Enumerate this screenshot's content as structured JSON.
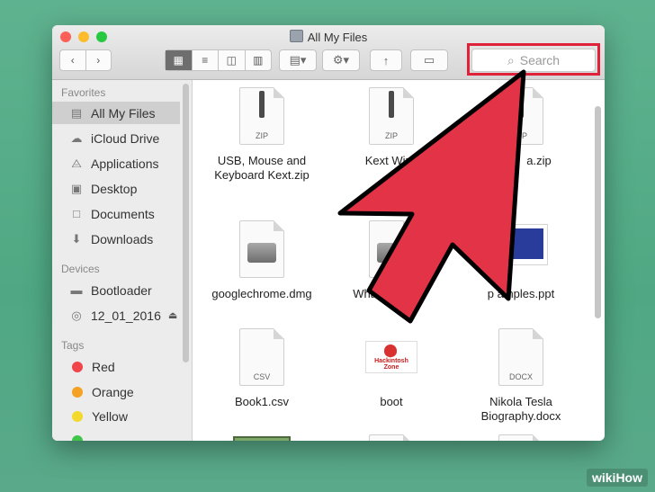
{
  "window": {
    "title": "All My Files"
  },
  "toolbar": {
    "back_icon": "chevron-left-icon",
    "forward_icon": "chevron-right-icon",
    "search_placeholder": "Search"
  },
  "sidebar": {
    "favorites_header": "Favorites",
    "favorites": [
      {
        "label": "All My Files",
        "icon": "all-files-icon",
        "selected": true
      },
      {
        "label": "iCloud Drive",
        "icon": "cloud-icon"
      },
      {
        "label": "Applications",
        "icon": "applications-icon"
      },
      {
        "label": "Desktop",
        "icon": "desktop-icon"
      },
      {
        "label": "Documents",
        "icon": "documents-icon"
      },
      {
        "label": "Downloads",
        "icon": "downloads-icon"
      }
    ],
    "devices_header": "Devices",
    "devices": [
      {
        "label": "Bootloader",
        "icon": "disk-icon"
      },
      {
        "label": "12_01_2016",
        "icon": "dvd-icon"
      }
    ],
    "tags_header": "Tags",
    "tags": [
      {
        "label": "Red",
        "color": "#f0454b"
      },
      {
        "label": "Orange",
        "color": "#f5a124"
      },
      {
        "label": "Yellow",
        "color": "#f2d92b"
      }
    ]
  },
  "files": [
    {
      "name": "USB, Mouse and Keyboard Kext.zip",
      "kind": "ZIP"
    },
    {
      "name": "Kext Wiza",
      "kind": "ZIP"
    },
    {
      "name": "a.zip",
      "kind": "ZIP"
    },
    {
      "name": "googlechrome.dmg",
      "kind": "DMG"
    },
    {
      "name": "WhatsA",
      "kind": "DMG"
    },
    {
      "name": "p amples.ppt",
      "kind": "PPT"
    },
    {
      "name": "Book1.csv",
      "kind": "CSV"
    },
    {
      "name": "boot",
      "kind": "IMG",
      "label": "Hackintosh Zone"
    },
    {
      "name": "Nikola Tesla Biography.docx",
      "kind": "DOCX"
    },
    {
      "name": "",
      "kind": "WIKI",
      "label": "wiki"
    }
  ],
  "watermark": "wikiHow",
  "colors": {
    "highlight": "#e0213a",
    "arrow": "#e23446"
  }
}
